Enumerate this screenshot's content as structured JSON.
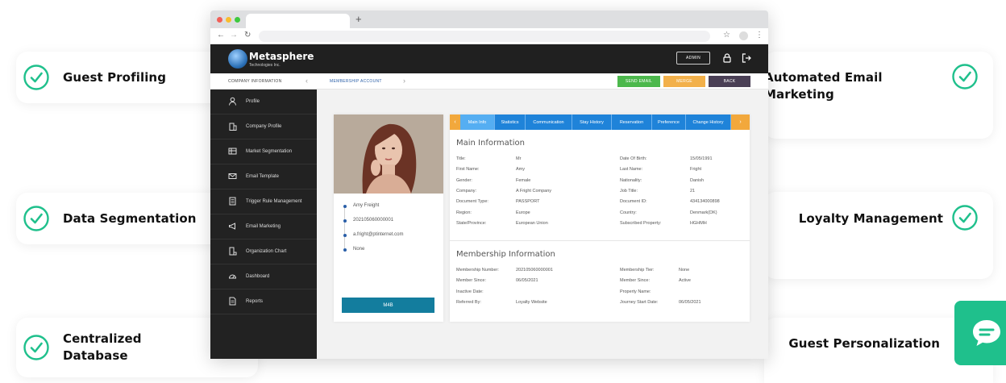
{
  "features_left": [
    {
      "label": "Guest Profiling"
    },
    {
      "label": "Data Segmentation"
    },
    {
      "label_line1": "Centralized",
      "label_line2": "Database"
    }
  ],
  "features_right": [
    {
      "label": "Automated Email Marketing"
    },
    {
      "label": "Loyalty Management"
    },
    {
      "label": "Guest Personalization"
    }
  ],
  "colors": {
    "accent_green": "#1fc08c",
    "tab_blue": "#1f83d9",
    "send_email": "#4cb84c",
    "merge": "#f2b04a",
    "back": "#4a3f55"
  },
  "browser": {
    "new_tab_symbol": "+"
  },
  "app": {
    "brand": "Metasphere",
    "brand_sub": "Technologies Inc.",
    "admin_label": "ADMIN"
  },
  "subbar": {
    "company_info": "COMPANY INFORMATION",
    "prev": "‹",
    "membership_account": "MEMBERSHIP ACCOUNT",
    "next": "›",
    "send_email": "SEND EMAIL",
    "merge": "MERGE",
    "back": "BACK"
  },
  "sidebar": {
    "items": [
      {
        "label": "Profile",
        "icon": "user-icon"
      },
      {
        "label": "Company Profile",
        "icon": "building-icon"
      },
      {
        "label": "Market Segmentation",
        "icon": "segment-icon"
      },
      {
        "label": "Email Template",
        "icon": "envelope-icon"
      },
      {
        "label": "Trigger Rule Management",
        "icon": "rules-icon"
      },
      {
        "label": "Email Marketing",
        "icon": "megaphone-icon"
      },
      {
        "label": "Organization Chart",
        "icon": "org-chart-icon"
      },
      {
        "label": "Dashboard",
        "icon": "gauge-icon"
      },
      {
        "label": "Reports",
        "icon": "report-icon"
      }
    ]
  },
  "profile": {
    "name": "Amy Freight",
    "membership_number": "202105060000001",
    "email": "a.fright@ptinternet.com",
    "extra": "None",
    "m4b_button": "M4B"
  },
  "tabs": [
    "Main Info",
    "Statistics",
    "Communication",
    "Stay History",
    "Reservation",
    "Preference",
    "Change History"
  ],
  "main_info": {
    "title": "Main Information",
    "left": [
      {
        "k": "Title:",
        "v": "Mr"
      },
      {
        "k": "First Name:",
        "v": "Amy"
      },
      {
        "k": "Gender:",
        "v": "Female"
      },
      {
        "k": "Company:",
        "v": "A Fright Company"
      },
      {
        "k": "Document Type:",
        "v": "PASSPORT"
      },
      {
        "k": "Region:",
        "v": "Europe"
      },
      {
        "k": "State/Province:",
        "v": "European Union"
      }
    ],
    "right": [
      {
        "k": "Date Of Birth:",
        "v": "15/05/1991"
      },
      {
        "k": "Last Name:",
        "v": "Fright"
      },
      {
        "k": "Nationality:",
        "v": "Danish"
      },
      {
        "k": "Job Title:",
        "v": "21"
      },
      {
        "k": "Document ID:",
        "v": "434134000898"
      },
      {
        "k": "Country:",
        "v": "Denmark(DK)"
      },
      {
        "k": "Subscribed Property:",
        "v": "HGHMH"
      }
    ]
  },
  "membership_info": {
    "title": "Membership Information",
    "left": [
      {
        "k": "Membership Number:",
        "v": "202105060000001"
      },
      {
        "k": "Member Since:",
        "v": "06/05/2021"
      },
      {
        "k": "Inactive Date:",
        "v": ""
      },
      {
        "k": "Referred By:",
        "v": "Loyalty Website"
      }
    ],
    "right": [
      {
        "k": "Membership Tier:",
        "v": "None"
      },
      {
        "k": "Member Since:",
        "v": "Active"
      },
      {
        "k": "Property Name:",
        "v": ""
      },
      {
        "k": "Journey Start Date:",
        "v": "06/05/2021"
      }
    ]
  }
}
